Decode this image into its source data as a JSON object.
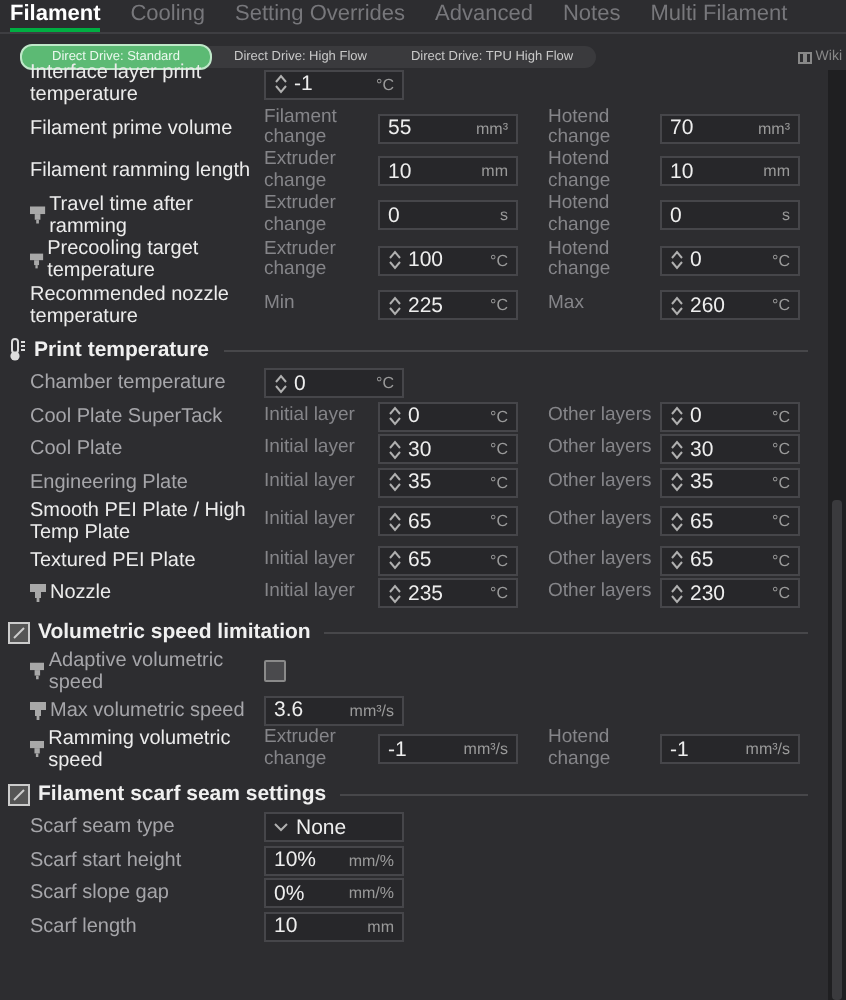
{
  "tabs": [
    {
      "label": "Filament",
      "selected": true
    },
    {
      "label": "Cooling",
      "selected": false
    },
    {
      "label": "Setting Overrides",
      "selected": false
    },
    {
      "label": "Advanced",
      "selected": false
    },
    {
      "label": "Notes",
      "selected": false
    },
    {
      "label": "Multi Filament",
      "selected": false
    }
  ],
  "presets": [
    {
      "label": "Direct Drive: Standard",
      "selected": true
    },
    {
      "label": "Direct Drive: High Flow",
      "selected": false
    },
    {
      "label": "Direct Drive: TPU High Flow",
      "selected": false
    }
  ],
  "wiki": "Wiki",
  "top_rows": [
    {
      "kind": "single",
      "label": "Interface layer print temperature",
      "modified": true,
      "nozzle_icon": false,
      "field": {
        "value": "-1",
        "unit": "°C",
        "spinner": true
      }
    },
    {
      "kind": "pair",
      "label": "Filament prime volume",
      "modified": true,
      "nozzle_icon": false,
      "fields": [
        {
          "caption": "Filament change",
          "value": "55",
          "unit": "mm³",
          "spinner": false
        },
        {
          "caption": "Hotend change",
          "value": "70",
          "unit": "mm³",
          "spinner": false
        }
      ]
    },
    {
      "kind": "pair",
      "label": "Filament ramming length",
      "modified": true,
      "nozzle_icon": false,
      "fields": [
        {
          "caption": "Extruder change",
          "value": "10",
          "unit": "mm",
          "spinner": false
        },
        {
          "caption": "Hotend change",
          "value": "10",
          "unit": "mm",
          "spinner": false
        }
      ]
    },
    {
      "kind": "pair",
      "label": "Travel time after ramming",
      "modified": true,
      "nozzle_icon": true,
      "fields": [
        {
          "caption": "Extruder change",
          "value": "0",
          "unit": "s",
          "spinner": false
        },
        {
          "caption": "Hotend change",
          "value": "0",
          "unit": "s",
          "spinner": false
        }
      ]
    },
    {
      "kind": "pair",
      "label": "Precooling target temperature",
      "modified": true,
      "nozzle_icon": true,
      "fields": [
        {
          "caption": "Extruder change",
          "value": "100",
          "unit": "°C",
          "spinner": true
        },
        {
          "caption": "Hotend change",
          "value": "0",
          "unit": "°C",
          "spinner": true
        }
      ]
    },
    {
      "kind": "pair",
      "label": "Recommended nozzle temperature",
      "modified": true,
      "nozzle_icon": false,
      "fields": [
        {
          "caption": "Min",
          "value": "225",
          "unit": "°C",
          "spinner": true
        },
        {
          "caption": "Max",
          "value": "260",
          "unit": "°C",
          "spinner": true
        }
      ]
    }
  ],
  "sections": [
    {
      "title": "Print temperature",
      "rows": [
        {
          "kind": "single",
          "label": "Chamber temperature",
          "modified": false,
          "nozzle_icon": false,
          "field": {
            "value": "0",
            "unit": "°C",
            "spinner": true
          }
        },
        {
          "kind": "pair",
          "label": "Cool Plate SuperTack",
          "modified": false,
          "nozzle_icon": false,
          "fields": [
            {
              "caption": "Initial layer",
              "value": "0",
              "unit": "°C",
              "spinner": true
            },
            {
              "caption": "Other layers",
              "value": "0",
              "unit": "°C",
              "spinner": true
            }
          ]
        },
        {
          "kind": "pair",
          "label": "Cool Plate",
          "modified": false,
          "nozzle_icon": false,
          "fields": [
            {
              "caption": "Initial layer",
              "value": "30",
              "unit": "°C",
              "spinner": true
            },
            {
              "caption": "Other layers",
              "value": "30",
              "unit": "°C",
              "spinner": true
            }
          ]
        },
        {
          "kind": "pair",
          "label": "Engineering Plate",
          "modified": false,
          "nozzle_icon": false,
          "fields": [
            {
              "caption": "Initial layer",
              "value": "35",
              "unit": "°C",
              "spinner": true
            },
            {
              "caption": "Other layers",
              "value": "35",
              "unit": "°C",
              "spinner": true
            }
          ]
        },
        {
          "kind": "pair",
          "label": "Smooth PEI Plate / High Temp Plate",
          "modified": true,
          "nozzle_icon": false,
          "fields": [
            {
              "caption": "Initial layer",
              "value": "65",
              "unit": "°C",
              "spinner": true
            },
            {
              "caption": "Other layers",
              "value": "65",
              "unit": "°C",
              "spinner": true
            }
          ]
        },
        {
          "kind": "pair",
          "label": "Textured PEI Plate",
          "modified": true,
          "nozzle_icon": false,
          "fields": [
            {
              "caption": "Initial layer",
              "value": "65",
              "unit": "°C",
              "spinner": true
            },
            {
              "caption": "Other layers",
              "value": "65",
              "unit": "°C",
              "spinner": true
            }
          ]
        },
        {
          "kind": "pair",
          "label": "Nozzle",
          "modified": true,
          "nozzle_icon": true,
          "fields": [
            {
              "caption": "Initial layer",
              "value": "235",
              "unit": "°C",
              "spinner": true
            },
            {
              "caption": "Other layers",
              "value": "230",
              "unit": "°C",
              "spinner": true
            }
          ]
        }
      ]
    },
    {
      "title": "Volumetric speed limitation",
      "rows": [
        {
          "kind": "checkbox",
          "label": "Adaptive volumetric speed",
          "modified": false,
          "nozzle_icon": true,
          "checked": false
        },
        {
          "kind": "single",
          "label": "Max volumetric speed",
          "modified": false,
          "nozzle_icon": true,
          "field": {
            "value": "3.6",
            "unit": "mm³/s",
            "spinner": false
          }
        },
        {
          "kind": "pair",
          "label": "Ramming volumetric speed",
          "modified": true,
          "nozzle_icon": true,
          "fields": [
            {
              "caption": "Extruder change",
              "value": "-1",
              "unit": "mm³/s",
              "spinner": false
            },
            {
              "caption": "Hotend change",
              "value": "-1",
              "unit": "mm³/s",
              "spinner": false
            }
          ]
        }
      ]
    },
    {
      "title": "Filament scarf seam settings",
      "rows": [
        {
          "kind": "dropdown",
          "label": "Scarf seam type",
          "modified": false,
          "nozzle_icon": false,
          "value": "None"
        },
        {
          "kind": "single",
          "label": "Scarf start height",
          "modified": false,
          "nozzle_icon": false,
          "field": {
            "value": "10%",
            "unit": "mm/%",
            "spinner": false
          }
        },
        {
          "kind": "single",
          "label": "Scarf slope gap",
          "modified": false,
          "nozzle_icon": false,
          "field": {
            "value": "0%",
            "unit": "mm/%",
            "spinner": false
          }
        },
        {
          "kind": "single",
          "label": "Scarf length",
          "modified": false,
          "nozzle_icon": false,
          "field": {
            "value": "10",
            "unit": "mm",
            "spinner": false
          }
        }
      ]
    }
  ]
}
